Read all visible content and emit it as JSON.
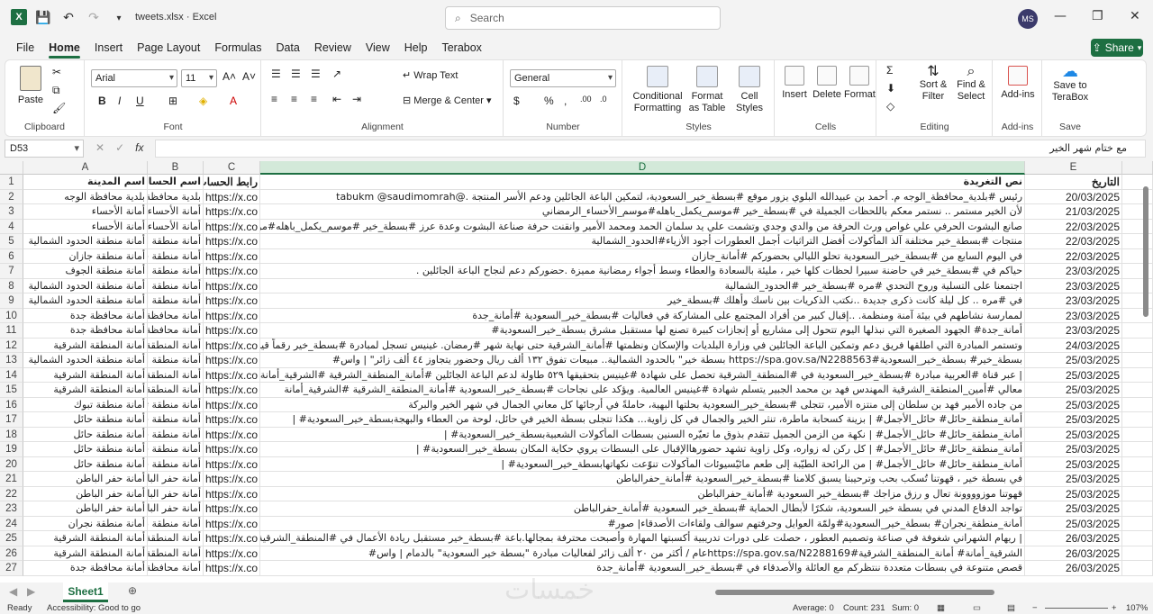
{
  "app": {
    "logo_letter": "X",
    "doc_title": "tweets.xlsx  ·  Excel",
    "search_placeholder": "Search",
    "user_initials": "MS",
    "accent": "#1d6f42"
  },
  "menu": {
    "tabs": [
      "File",
      "Home",
      "Insert",
      "Page Layout",
      "Formulas",
      "Data",
      "Review",
      "View",
      "Help",
      "Terabox"
    ],
    "active": "Home",
    "share_label": "Share"
  },
  "ribbon": {
    "clipboard": {
      "paste": "Paste",
      "label": "Clipboard"
    },
    "font": {
      "name": "Arial",
      "size": "11",
      "label": "Font"
    },
    "alignment": {
      "wrap": "Wrap Text",
      "merge": "Merge & Center",
      "label": "Alignment"
    },
    "number": {
      "format": "General",
      "label": "Number"
    },
    "styles": {
      "conditional": "Conditional Formatting",
      "format_table": "Format as Table",
      "cell_styles": "Cell Styles",
      "label": "Styles"
    },
    "cells": {
      "insert": "Insert",
      "delete": "Delete",
      "format": "Format",
      "label": "Cells"
    },
    "editing": {
      "sort": "Sort & Filter",
      "find": "Find & Select",
      "label": "Editing"
    },
    "addins": {
      "addins": "Add-ins",
      "label": "Add-ins"
    },
    "save": {
      "terabox": "Save to TeraBox",
      "label": "Save"
    }
  },
  "formula_bar": {
    "name_box": "D53",
    "content": "مع ختام شهر الخير"
  },
  "grid": {
    "columns": [
      "A",
      "B",
      "C",
      "D",
      "E"
    ],
    "selected_column": "D",
    "headers": {
      "A": "اسم المدينة",
      "B": "اسم الحساب",
      "C": "رابط الحساب",
      "D": "نص التغريدة",
      "E": "التاريخ"
    },
    "rows": [
      {
        "n": "2",
        "A": "بلدية محافظة الوجه",
        "B": "بلدية محافظة",
        "C": "https://x.co",
        "D": "رئيس #بلدية_محافظة_الوجه م. أحمد بن عبيدالله البلوي يزور موقع #بسطة_خير_السعودية، لتمكين الباعة الجائلين ودعم الأسر المنتجة .@tabukm @saudimomrah",
        "E": "20/03/2025"
      },
      {
        "n": "3",
        "A": "أمانة الأحساء",
        "B": "أمانة الأحساء",
        "C": "https://x.co",
        "D": "لأن الخير مستمر .. نستمر معكم باللحظات الجميلة في #بسطة_خير #موسم_يكمل_باهله#موسم_الأحساء_الرمضاني",
        "E": "21/03/2025"
      },
      {
        "n": "4",
        "A": "أمانة الأحساء",
        "B": "أمانة الأحساء",
        "C": "https://x.co",
        "D": "صانع البشوت الحرفي علي غواص ورث الحرفة من والدي وجدي وتشمت علي يد سلمان الحمد ومحمد الأمير وانقنت حرفة صناعة البشوت وعدة عرز #بسطة_خير #موسم_يكمل_باهله#موسم",
        "E": "22/03/2025"
      },
      {
        "n": "5",
        "A": "أمانة منطقة الحدود الشمالية",
        "B": "أمانة منطقة ال",
        "C": "https://x.co",
        "D": "منتجات #بسطة_خير مختلفة آلذ المأكولات أفضل التراثيات أجمل العطورات أجود الأزياء#الحدود_الشمالية",
        "E": "22/03/2025"
      },
      {
        "n": "6",
        "A": "أمانة منطقة جازان",
        "B": "أمانة منطقة جا",
        "C": "https://x.co",
        "D": "في اليوم السابع من #بسطة_خير_السعودية تحلو الليالي بحضوركم #أمانة_جازان",
        "E": "22/03/2025"
      },
      {
        "n": "7",
        "A": "أمانة منطقة الجوف",
        "B": "أمانة منطقة ال",
        "C": "https://x.co",
        "D": "حياكم في #بسطة_خير في حاضنة سبيرا لحظات كلها خير ، مليئة بالسعادة والعطاء وسط أجواء رمضانية مميزة .حضوركم دعم لنجاح الباعة الجائلين .",
        "E": "23/03/2025"
      },
      {
        "n": "8",
        "A": "أمانة منطقة الحدود الشمالية",
        "B": "أمانة منطقة ال",
        "C": "https://x.co",
        "D": "اجتمعنا على التسلية وروح التحدي #مره #بسطة_خير #الحدود_الشمالية",
        "E": "23/03/2025"
      },
      {
        "n": "9",
        "A": "أمانة منطقة الحدود الشمالية",
        "B": "أمانة منطقة ال",
        "C": "https://x.co",
        "D": "في #مره .. كل ليلة كانت ذكرى جديدة ..نكتب الذكريات بين ناسك وأهلك #بسطة_خير",
        "E": "23/03/2025"
      },
      {
        "n": "10",
        "A": "أمانة محافظة جدة",
        "B": "أمانة محافظة",
        "C": "https://x.co",
        "D": "لممارسة نشاطهم في بيئة آمنة ومنظمة. ..إقبال كبير من أفراد المجتمع على المشاركة في فعاليات #بسطة_خير_السعودية #أمانة_جدة",
        "E": "23/03/2025"
      },
      {
        "n": "11",
        "A": "أمانة محافظة جدة",
        "B": "أمانة محافظة",
        "C": "https://x.co",
        "D": "أمانة_جدة# الجهود الصغيرة التي نبذلها اليوم تتحول إلى مشاريع أو إنجازات كبيرة تصنع لها مستقبل مشرق بسطة_خير_السعودية#",
        "E": "23/03/2025"
      },
      {
        "n": "12",
        "A": "أمانة المنطقة الشرقية",
        "B": "أمانة المنطقة",
        "C": "https://x.co",
        "D": "وتستمر المبادرة التي اطلقها فريق دعم وتمكين الباعة الجائلين في وزارة البلديات والإسكان ونظمتها #أمانة_الشرقية حتى نهاية شهر #رمضان. غينيس تسجل لمبادرة #بسطة_خير رقماً قياسياً في",
        "E": "24/03/2025"
      },
      {
        "n": "13",
        "A": "أمانة منطقة الحدود الشمالية",
        "B": "أمانة منطقة ال",
        "C": "https://x.co",
        "D": "بسطة_خير# بسطة_خير_السعودية#https://spa.gov.sa/N2288563 بسطة خير\" بالحدود الشمالية.. مبيعات تفوق ١٣٢ ألف ريال وحضور يتجاوز ٤٤ ألف زائر\" | واس#",
        "E": "25/03/2025"
      },
      {
        "n": "14",
        "A": "أمانة المنطقة الشرقية",
        "B": "أمانة المنطقة",
        "C": "https://x.co",
        "D": "| عبر قناة #العربية مبادرة #بسطة_خير_السعودية في #المنطقة_الشرقية تحصل على شهادة #غينيس بتحقيقها ٥٢٩ طاولة لدعم الباعة الجائلين #أمانة_المنطقة_الشرقية #الشرقية_أمانة#موسم_ر",
        "E": "25/03/2025"
      },
      {
        "n": "15",
        "A": "أمانة المنطقة الشرقية",
        "B": "أمانة المنطقة",
        "C": "https://x.co",
        "D": "معالي #أمين_المنطقة_الشرقية المهندس فهد بن محمد الجبير يتسلم شهادة #غينيس العالمية. ويؤكد على نجاحات #بسطة_خير_السعودية #أمانة_المنطقة_الشرقية #الشرقية_أمانة",
        "E": "25/03/2025"
      },
      {
        "n": "16",
        "A": "أمانة منطقة تبوك",
        "B": "أمانة منطقة تب",
        "C": "https://x.co",
        "D": "من جاده الأمير فهد بن سلطان إلى منتزه الأمير، تتجلى #بسطة_خير_السعودية بحلتها البهية، حاملةً في أرجائها كل معاني الجمال في شهر الخير والبركة",
        "E": "25/03/2025"
      },
      {
        "n": "17",
        "A": "أمانة منطقة حائل",
        "B": "أمانة منطقة حا",
        "C": "https://x.co",
        "D": "أمانة_منطقة_حائل# حائل_الأجمل# | بزينة كسحابة ماطرة، تنثر الخير والجمال في كل زاوية... هكذا تتجلى بسطة الخير في حائل، لوحة من العطاء والبهجةبسطة_خير_السعودية# |",
        "E": "25/03/2025"
      },
      {
        "n": "18",
        "A": "أمانة منطقة حائل",
        "B": "أمانة منطقة حا",
        "C": "https://x.co",
        "D": "أمانة_منطقة_حائل# حائل_الأجمل# | نكهة من الزمن الجميل تتقدم بذوق ما تعيّره السنين بسطات المأكولات الشعبيةبسطة_خير_السعودية# |",
        "E": "25/03/2025"
      },
      {
        "n": "19",
        "A": "أمانة منطقة حائل",
        "B": "أمانة منطقة حا",
        "C": "https://x.co",
        "D": "أمانة_منطقة_حائل# حائل_الأجمل# | كل ركن له زواره، وكل زاوية تشهد حضورهاالإقبال على البسطات يروي حكاية المكان بسطة_خير_السعودية# |",
        "E": "25/03/2025"
      },
      {
        "n": "20",
        "A": "أمانة منطقة حائل",
        "B": "أمانة منطقة حا",
        "C": "https://x.co",
        "D": "أمانة_منطقة_حائل# حائل_الأجمل# | من الرائحة الطيّبة إلى طعم مائيّسيوئات المأكولات تنوّعت نكهاتهابسطة_خير_السعودية# |",
        "E": "25/03/2025"
      },
      {
        "n": "21",
        "A": "أمانة حفر الباطن",
        "B": "أمانة حفر الباط",
        "C": "https://x.co",
        "D": "في بسطة خير ، قهوتنا تُسكب بحب وترحيبنا يسبق كلامنا #بسطة_خير_السعودية #أمانة_حفرالباطن",
        "E": "25/03/2025"
      },
      {
        "n": "22",
        "A": "أمانة حفر الباطن",
        "B": "أمانة حفر الباط",
        "C": "https://x.co",
        "D": "قهوتنا موزوووونة تعال و رزق مزاجك #بسطة_خير السعودية #أمانة_حفرالباطن",
        "E": "25/03/2025"
      },
      {
        "n": "23",
        "A": "أمانة حفر الباطن",
        "B": "أمانة حفر الباط",
        "C": "https://x.co",
        "D": "تواجد الدفاع المدني في بسطة خير السعودية، شكرًا لأبطال الحماية #بسطة_خير السعودية #أمانة_حفرالباطن",
        "E": "25/03/2025"
      },
      {
        "n": "24",
        "A": "أمانة منطقة نجران",
        "B": "أمانة منطقة نج",
        "C": "https://x.co",
        "D": "أمانة_منطقة_نجران# بسطة_خير_السعودية#ولمّة العوايل وحرفتهم سوالف ولقاءات الأصدقاء| صور#",
        "E": "25/03/2025"
      },
      {
        "n": "25",
        "A": "أمانة المنطقة الشرقية",
        "B": "أمانة المنطقة",
        "C": "https://x.co",
        "D": "| ريهام الشهراني شغوفة في صناعة وتصميم العطور ، حصلت على دورات تدريبية أكسبتها المهارة وأصبحت محترفة بمجالها.باعة #بسطة_خير مستقبل ريادة الأعمال في #المنطقة_الشرقية #أما",
        "E": "26/03/2025"
      },
      {
        "n": "26",
        "A": "أمانة المنطقة الشرقية",
        "B": "أمانة المنطقة",
        "C": "https://x.co",
        "D": "الشرقية_أمانة# أمانة_المنطقة_الشرقية#https://spa.gov.sa/N2288169عام / أكثر من ٢٠ ألف زائر لفعاليات مبادرة \"بسطة خير السعودية\" بالدمام | واس#",
        "E": "26/03/2025"
      },
      {
        "n": "27",
        "A": "أمانة محافظة جدة",
        "B": "أمانة محافظة",
        "C": "https://x.co",
        "D": "قصص متنوعة في بسطات متعددة ننتظركم مع العائلة والأصدقاء في #بسطة_خير_السعودية #أمانة_جدة",
        "E": "26/03/2025"
      }
    ]
  },
  "sheets": {
    "active": "Sheet1"
  },
  "status": {
    "ready": "Ready",
    "accessibility": "Accessibility: Good to go",
    "average": "Average: 0",
    "count": "Count: 231",
    "sum": "Sum: 0",
    "zoom": "107%"
  },
  "watermark": "خمسات"
}
